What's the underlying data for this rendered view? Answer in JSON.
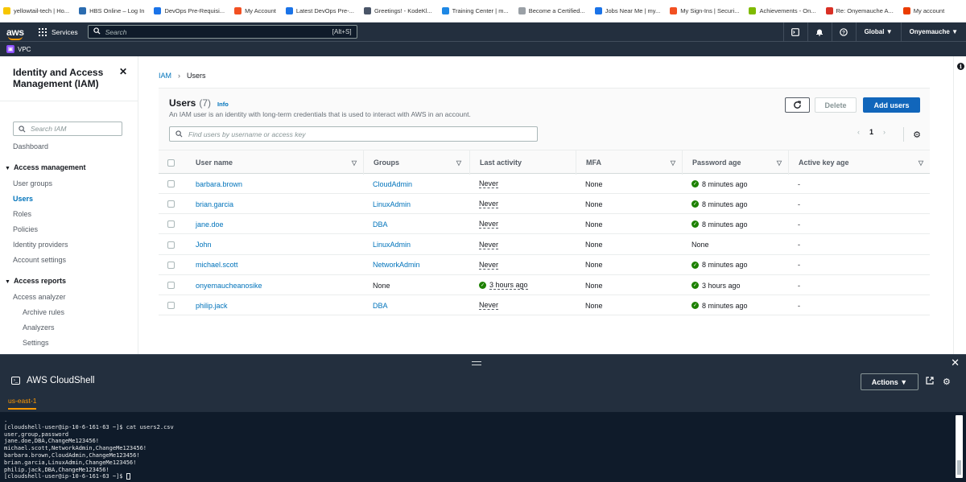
{
  "bookmarks": [
    {
      "label": "yellowtail-tech | Ho...",
      "color": "#f7c600"
    },
    {
      "label": "HBS Online – Log In",
      "color": "#2b6cb0"
    },
    {
      "label": "DevOps Pre-Requisi...",
      "color": "#1a73e8"
    },
    {
      "label": "My Account",
      "color": "#f25022"
    },
    {
      "label": "Latest DevOps Pre-...",
      "color": "#1a73e8"
    },
    {
      "label": "Greetings! - KodeKl...",
      "color": "#4a5568"
    },
    {
      "label": "Training Center | m...",
      "color": "#1e88e5"
    },
    {
      "label": "Become a Certified...",
      "color": "#9aa0a6"
    },
    {
      "label": "Jobs Near Me | my...",
      "color": "#1a73e8"
    },
    {
      "label": "My Sign-Ins | Securi...",
      "color": "#f25022"
    },
    {
      "label": "Achievements - On...",
      "color": "#7fba00"
    },
    {
      "label": "Re: Onyemauche A...",
      "color": "#d93025"
    },
    {
      "label": "My account",
      "color": "#eb3c00"
    }
  ],
  "topnav": {
    "logo": "aws",
    "services_label": "Services",
    "search_placeholder": "Search",
    "search_shortcut": "[Alt+S]",
    "region": "Global ▼",
    "account": "Onyemauche ▼"
  },
  "favorites": {
    "vpc_label": "VPC"
  },
  "sidebar": {
    "title": "Identity and Access Management (IAM)",
    "search_placeholder": "Search IAM",
    "dashboard": "Dashboard",
    "section_access_management": "Access management",
    "items": [
      "User groups",
      "Users",
      "Roles",
      "Policies",
      "Identity providers",
      "Account settings"
    ],
    "section_access_reports": "Access reports",
    "access_analyzer": "Access analyzer",
    "analyzer_items": [
      "Archive rules",
      "Analyzers",
      "Settings"
    ]
  },
  "breadcrumb": {
    "root": "IAM",
    "current": "Users"
  },
  "users_panel": {
    "title": "Users",
    "count": "(7)",
    "info": "Info",
    "description": "An IAM user is an identity with long-term credentials that is used to interact with AWS in an account.",
    "delete_label": "Delete",
    "add_label": "Add users",
    "filter_placeholder": "Find users by username or access key",
    "page": "1"
  },
  "table": {
    "columns": [
      "User name",
      "Groups",
      "Last activity",
      "MFA",
      "Password age",
      "Active key age"
    ],
    "rows": [
      {
        "user": "barbara.brown",
        "group": "CloudAdmin",
        "group_link": true,
        "activity": "Never",
        "activity_ok": false,
        "mfa": "None",
        "pwd": "8 minutes ago",
        "pwd_ok": true,
        "key": "-"
      },
      {
        "user": "brian.garcia",
        "group": "LinuxAdmin",
        "group_link": true,
        "activity": "Never",
        "activity_ok": false,
        "mfa": "None",
        "pwd": "8 minutes ago",
        "pwd_ok": true,
        "key": "-"
      },
      {
        "user": "jane.doe",
        "group": "DBA",
        "group_link": true,
        "activity": "Never",
        "activity_ok": false,
        "mfa": "None",
        "pwd": "8 minutes ago",
        "pwd_ok": true,
        "key": "-"
      },
      {
        "user": "John",
        "group": "LinuxAdmin",
        "group_link": true,
        "activity": "Never",
        "activity_ok": false,
        "mfa": "None",
        "pwd": "None",
        "pwd_ok": false,
        "key": "-"
      },
      {
        "user": "michael.scott",
        "group": "NetworkAdmin",
        "group_link": true,
        "activity": "Never",
        "activity_ok": false,
        "mfa": "None",
        "pwd": "8 minutes ago",
        "pwd_ok": true,
        "key": "-"
      },
      {
        "user": "onyemaucheanosike",
        "group": "None",
        "group_link": false,
        "activity": "3 hours ago",
        "activity_ok": true,
        "mfa": "None",
        "pwd": "3 hours ago",
        "pwd_ok": true,
        "key": "-"
      },
      {
        "user": "philip.jack",
        "group": "DBA",
        "group_link": true,
        "activity": "Never",
        "activity_ok": false,
        "mfa": "None",
        "pwd": "8 minutes ago",
        "pwd_ok": true,
        "key": "-"
      }
    ]
  },
  "cloudshell": {
    "title": "AWS CloudShell",
    "actions_label": "Actions ▼",
    "region_tab": "us-east-1",
    "lines": [
      ".",
      "[cloudshell-user@ip-10-6-161-63 ~]$ cat users2.csv",
      "user,group,password",
      "jane.doe,DBA,ChangeMe123456!",
      "michael.scott,NetworkAdmin,ChangeMe123456!",
      "barbara.brown,CloudAdmin,ChangeMe123456!",
      "brian.garcia,LinuxAdmin,ChangeMe123456!",
      "philip.jack,DBA,ChangeMe123456!"
    ],
    "prompt": "[cloudshell-user@ip-10-6-161-63 ~]$ "
  },
  "colors": {
    "aws_nav": "#232f3e",
    "link": "#0073bb",
    "primary_button": "#1166bb",
    "success": "#1d8102",
    "accent": "#ff9900"
  }
}
